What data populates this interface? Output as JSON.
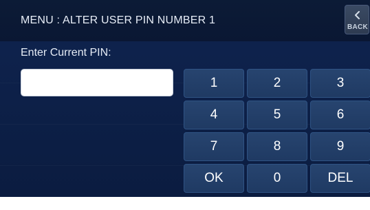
{
  "header": {
    "title": "MENU : ALTER USER PIN NUMBER 1",
    "back_label": "BACK"
  },
  "prompt": {
    "label": "Enter Current PIN:"
  },
  "pin_input": {
    "value": "",
    "placeholder": ""
  },
  "keypad": {
    "keys": [
      "1",
      "2",
      "3",
      "4",
      "5",
      "6",
      "7",
      "8",
      "9",
      "OK",
      "0",
      "DEL"
    ]
  },
  "colors": {
    "background": "#0f2450",
    "header": "#0c1b36",
    "key": "#27446f",
    "text": "#ffffff"
  }
}
